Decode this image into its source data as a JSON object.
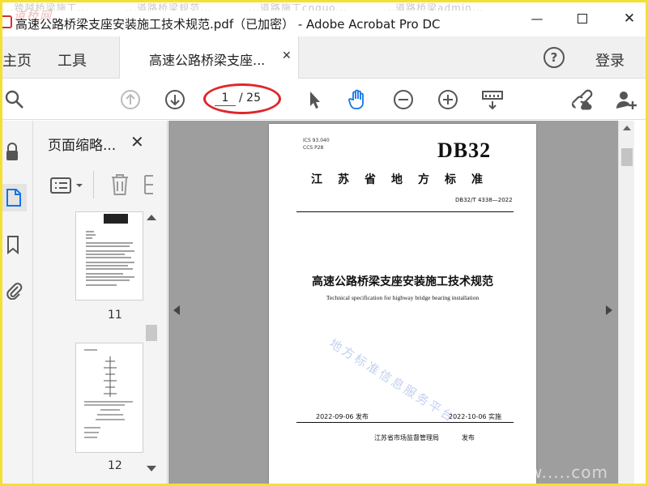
{
  "window": {
    "title": "高速公路桥梁支座安装施工技术规范.pdf（已加密） - Adobe Acrobat Pro DC",
    "ghost_tabs": [
      "...跨越桥梁施工...",
      "...道路桥梁规范...",
      "...道路施工cnquo...",
      "...道路桥梁admin..."
    ],
    "watermark_logo": "道桥网"
  },
  "tabbar": {
    "home": "主页",
    "tools": "工具",
    "doc_tab": "高速公路桥梁支座...",
    "login": "登录"
  },
  "toolbar": {
    "page_current": "1",
    "page_total": "/ 25"
  },
  "thumbnails": {
    "title": "页面缩略...",
    "pages": [
      {
        "label": "11"
      },
      {
        "label": "12"
      }
    ]
  },
  "document": {
    "ics": "ICS 93.040\nCCS P28",
    "std_prefix": "DB32",
    "std_kind": "江苏省地方标准",
    "std_code": "DB32/T 4338—2022",
    "title_cn": "高速公路桥梁支座安装施工技术规范",
    "title_en": "Technical specification for highway bridge bearing installation",
    "watermark": "地方标准信息服务平台",
    "pub_date": "2022-09-06 发布",
    "impl_date": "2022-10-06 实施",
    "issuer": "江苏省市场监督管理局",
    "issued": "发布"
  },
  "corner_watermark": "w.....com",
  "colors": {
    "highlight_ring": "#e0262b",
    "frame_border": "#f3e030",
    "doc_background": "#9e9e9e",
    "hand_tool_active": "#1473e6"
  }
}
